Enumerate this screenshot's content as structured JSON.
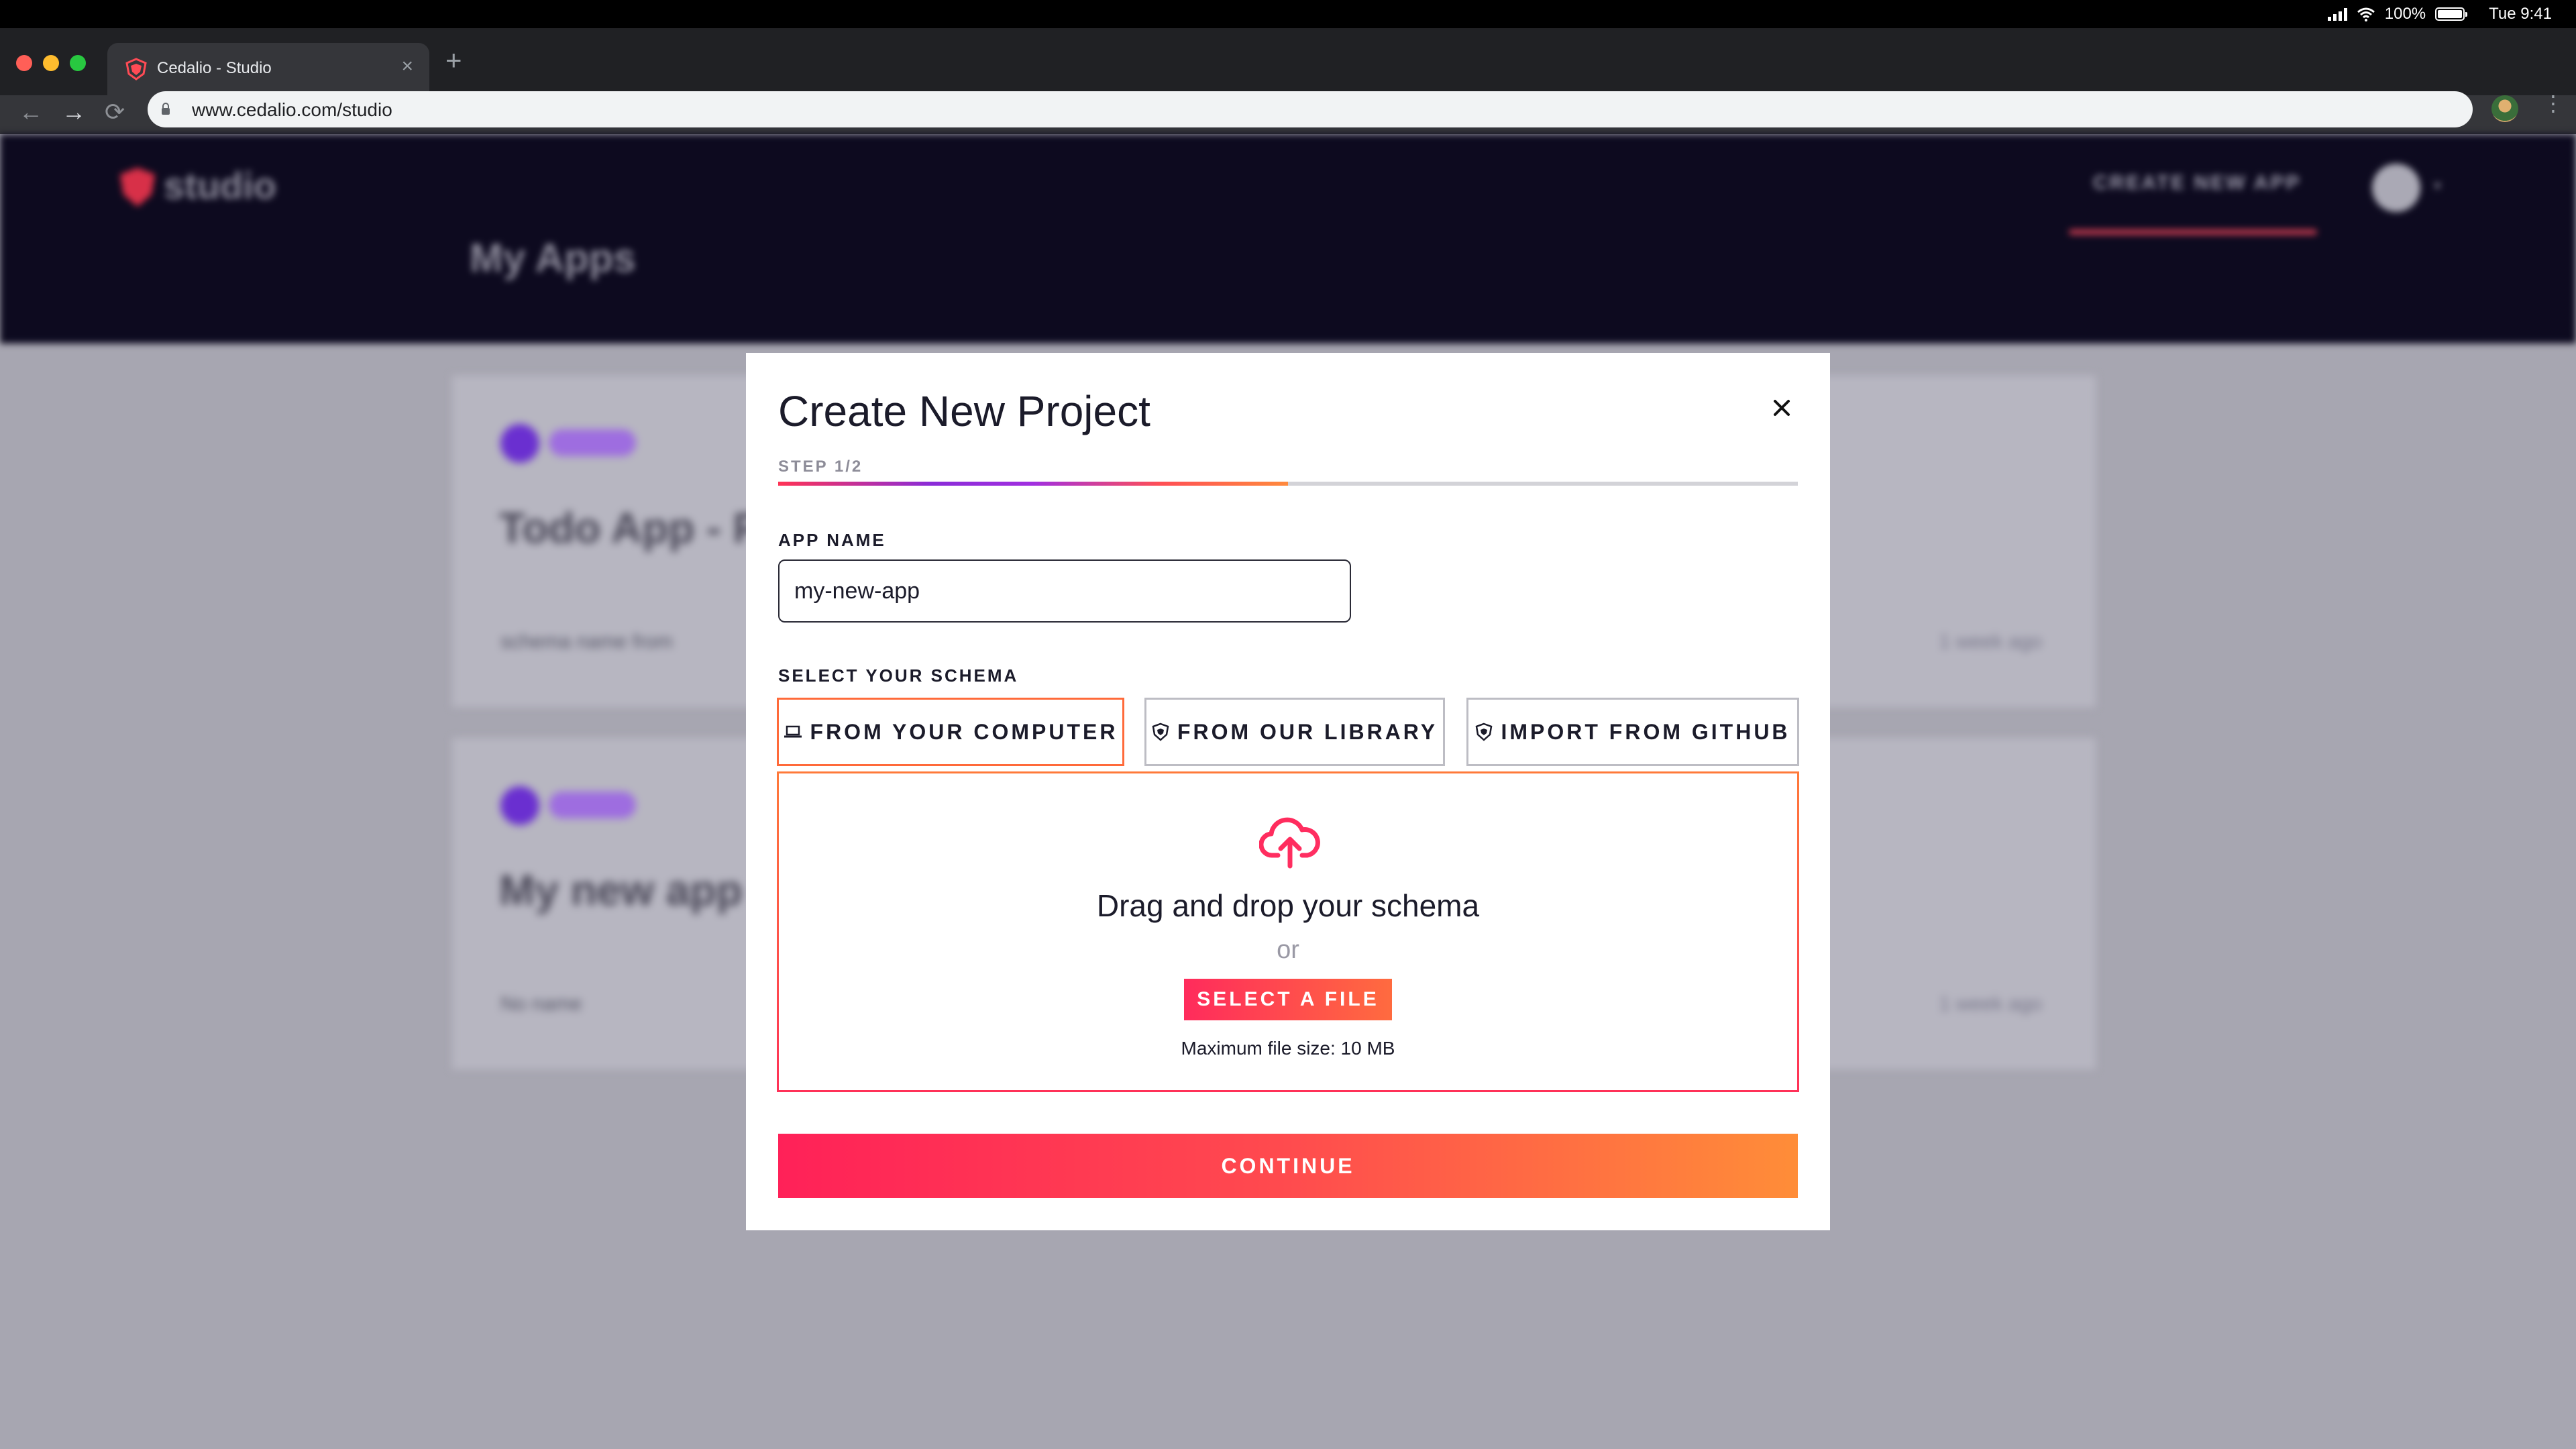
{
  "os": {
    "battery": "100%",
    "time": "Tue 9:41",
    "icons": [
      "signal-icon",
      "wifi-icon",
      "battery-icon"
    ]
  },
  "browser": {
    "tab_title": "Cedalio - Studio",
    "tab_close": "×",
    "new_tab": "+",
    "url": "www.cedalio.com/studio",
    "nav": {
      "back": "←",
      "forward": "→",
      "reload": "⟳",
      "menu": "⋮"
    }
  },
  "page": {
    "logo_text": "studio",
    "title": "My Apps",
    "cta": "CREATE NEW APP",
    "cards": [
      {
        "title": "Todo App - P",
        "line": "schema name from",
        "time": "1 week ago"
      },
      {
        "title": "My new app",
        "line": "No name",
        "time": "1 week ago"
      }
    ]
  },
  "modal": {
    "title": "Create New Project",
    "step": "STEP 1/2",
    "progress_fraction": 0.5,
    "app_name_label": "APP NAME",
    "app_name_value": "my-new-app",
    "schema_label": "SELECT YOUR SCHEMA",
    "tabs": [
      {
        "label": "FROM YOUR COMPUTER",
        "icon": "laptop-icon",
        "active": true
      },
      {
        "label": "FROM OUR LIBRARY",
        "icon": "library-icon",
        "active": false
      },
      {
        "label": "IMPORT FROM GITHUB",
        "icon": "github-icon",
        "active": false
      }
    ],
    "dropzone": {
      "icon": "cloud-upload-icon",
      "title": "Drag and drop your schema",
      "or": "or",
      "button": "SELECT A FILE",
      "max_size": "Maximum file size: 10 MB"
    },
    "continue": "CONTINUE"
  },
  "colors": {
    "accent_pink": "#ff2b5c",
    "accent_orange": "#ff8a3d",
    "accent_purple": "#8a2cd8",
    "header_dark": "#0d0a1f",
    "overlay": "#a7a6b1"
  }
}
